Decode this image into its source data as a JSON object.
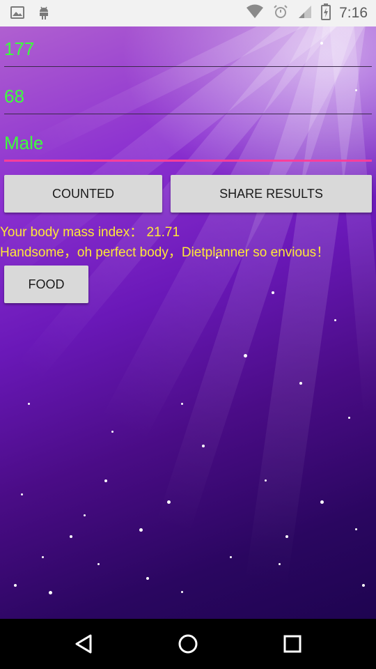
{
  "status_bar": {
    "time": "7:16",
    "left_icons": [
      "image-icon",
      "android-icon"
    ],
    "right_icons": [
      "wifi-icon",
      "alarm-icon",
      "signal-icon",
      "battery-icon"
    ]
  },
  "form": {
    "height_value": "177",
    "weight_value": "68",
    "gender_value": "Male"
  },
  "buttons": {
    "counted": "COUNTED",
    "share": "SHARE RESULTS",
    "food": "FOOD"
  },
  "result": {
    "bmi_line": "Your body mass index：  21.71",
    "comment_line": "Handsome，oh perfect body，Dietplanner so envious！"
  },
  "colors": {
    "input_text": "#3dff3d",
    "result_text": "#ffe838",
    "focus_underline": "#ff3e9a",
    "button_bg": "#d9d9d9"
  },
  "nav_bar": {
    "icons": [
      "back-icon",
      "home-icon",
      "recents-icon"
    ]
  }
}
